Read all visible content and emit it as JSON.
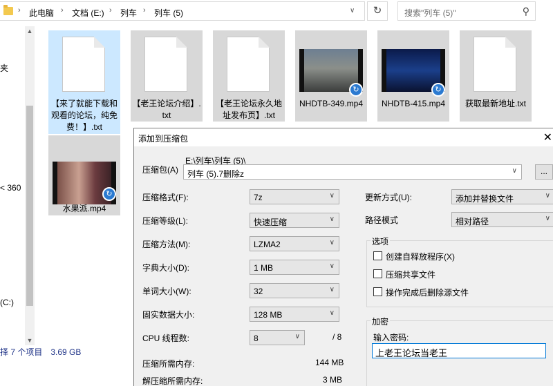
{
  "explorer": {
    "breadcrumb": [
      "此电脑",
      "文档 (E:)",
      "列车",
      "列车 (5)"
    ],
    "search_placeholder": "搜索\"列车 (5)\"",
    "nav_items": [
      "夹",
      "< 360",
      "(C:)"
    ],
    "files": [
      {
        "name": "【来了就能下载和观看的论坛，纯免费！】.txt",
        "kind": "text",
        "selected": true
      },
      {
        "name": "【老王论坛介绍】.txt",
        "kind": "text"
      },
      {
        "name": "【老王论坛永久地址发布页】.txt",
        "kind": "text"
      },
      {
        "name": "NHDTB-349.mp4",
        "kind": "video"
      },
      {
        "name": "NHDTB-415.mp4",
        "kind": "video"
      },
      {
        "name": "获取最新地址.txt",
        "kind": "text"
      },
      {
        "name": "水果派.mp4",
        "kind": "video"
      }
    ],
    "status": {
      "count": "择 7 个项目",
      "size": "3.69 GB"
    }
  },
  "dialog": {
    "title": "添加到压缩包",
    "archive_label": "压缩包(A)",
    "archive_path": "E:\\列车\\列车 (5)\\",
    "archive_name": "列车 (5).7删除z",
    "browse_label": "...",
    "format_label": "压缩格式(F):",
    "format_value": "7z",
    "level_label": "压缩等级(L):",
    "level_value": "快速压缩",
    "method_label": "压缩方法(M):",
    "method_value": "LZMA2",
    "dict_label": "字典大小(D):",
    "dict_value": "1 MB",
    "word_label": "单词大小(W):",
    "word_value": "32",
    "solid_label": "固实数据大小:",
    "solid_value": "128 MB",
    "cpu_label": "CPU 线程数:",
    "cpu_value": "8",
    "cpu_total": "/ 8",
    "mem_comp_label": "压缩所需内存:",
    "mem_comp_value": "144 MB",
    "mem_decomp_label": "解压缩所需内存:",
    "mem_decomp_value": "3 MB",
    "update_label": "更新方式(U):",
    "update_value": "添加并替换文件",
    "path_label": "路径模式",
    "path_value": "相对路径",
    "options_title": "选项",
    "options": [
      "创建自释放程序(X)",
      "压缩共享文件",
      "操作完成后删除源文件"
    ],
    "encrypt_title": "加密",
    "password_label": "输入密码:",
    "password_value": "上老王论坛当老王"
  },
  "colors": {
    "selection": "#cce8ff",
    "accent": "#0078d7",
    "status_text": "#1e3287"
  }
}
